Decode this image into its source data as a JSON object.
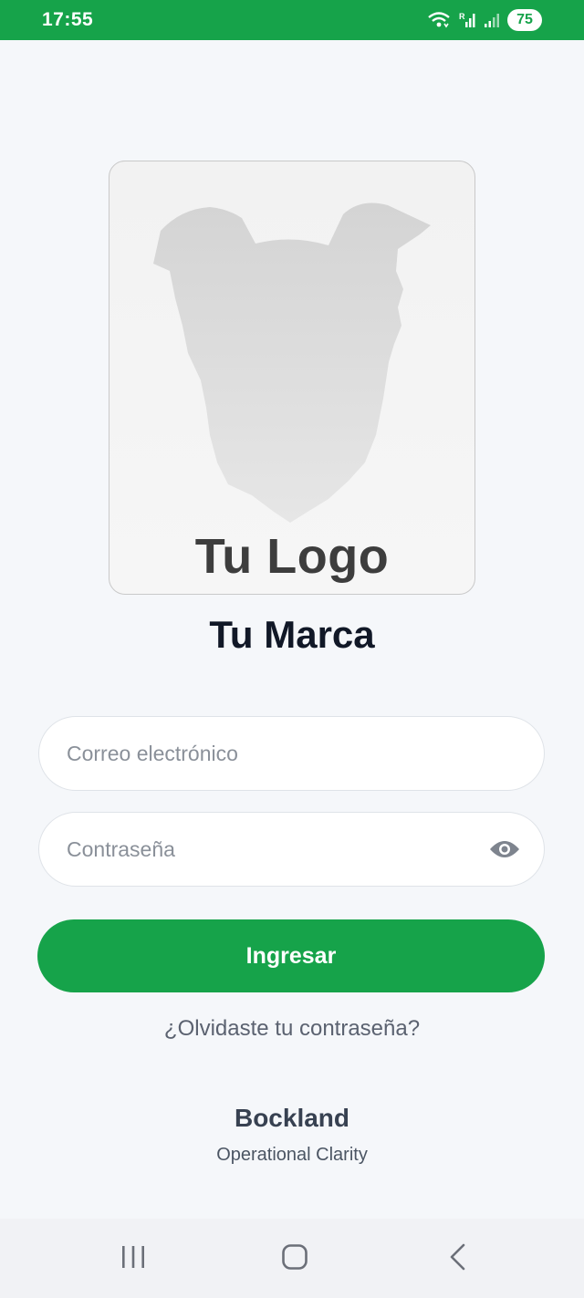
{
  "status_bar": {
    "time": "17:55",
    "battery": "75",
    "icons": [
      "wifi-icon",
      "signal-r-icon",
      "signal-icon",
      "battery-icon"
    ],
    "color": "#16a34a"
  },
  "logo": {
    "text": "Tu Logo",
    "graphic": "dog-silhouette"
  },
  "brand": {
    "title": "Tu Marca"
  },
  "form": {
    "email_placeholder": "Correo electrónico",
    "email_value": "",
    "password_placeholder": "Contraseña",
    "password_value": "",
    "submit_label": "Ingresar",
    "forgot_label": "¿Olvidaste tu contraseña?"
  },
  "footer": {
    "name": "Bockland",
    "tagline": "Operational Clarity"
  },
  "nav_bar": {
    "buttons": [
      "recent-apps-icon",
      "home-icon",
      "back-icon"
    ]
  },
  "colors": {
    "accent": "#16a34a",
    "background": "#f5f7fa",
    "title": "#111827"
  }
}
